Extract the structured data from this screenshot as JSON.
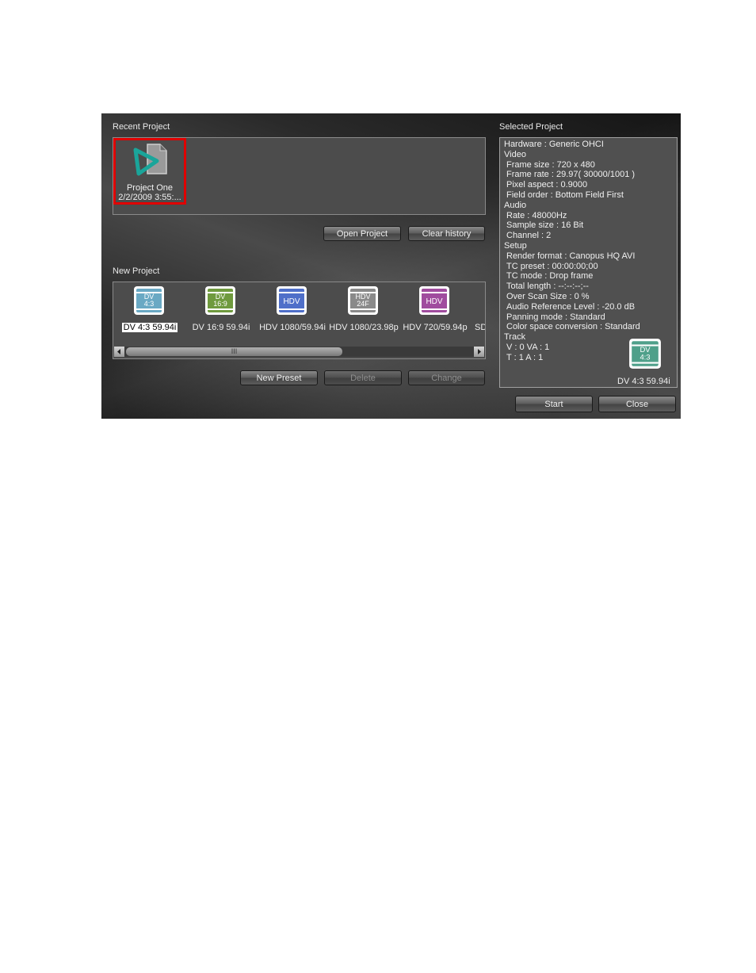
{
  "recent": {
    "title": "Recent Project",
    "items": [
      {
        "name": "Project One",
        "date": "2/2/2009 3:55:..."
      }
    ],
    "open_label": "Open Project",
    "clear_label": "Clear history"
  },
  "new_project": {
    "title": "New Project",
    "presets": [
      {
        "icon_top": "DV",
        "icon_bottom": "4:3",
        "label": "DV 4:3 59.94i",
        "color": "#6aa9c4"
      },
      {
        "icon_top": "DV",
        "icon_bottom": "16:9",
        "label": "DV 16:9 59.94i",
        "color": "#6f9a3e"
      },
      {
        "icon_top": "HDV",
        "icon_bottom": "",
        "label": "HDV 1080/59.94i",
        "color": "#4f6fc9"
      },
      {
        "icon_top": "HDV",
        "icon_bottom": "24F",
        "label": "HDV 1080/23.98p",
        "color": "#8a8a8a"
      },
      {
        "icon_top": "HDV",
        "icon_bottom": "",
        "label": "HDV 720/59.94p",
        "color": "#a04c9e"
      },
      {
        "label": "SD"
      }
    ],
    "scroll_grip": "III",
    "new_preset_label": "New Preset",
    "delete_label": "Delete",
    "change_label": "Change"
  },
  "selected": {
    "title": "Selected Project",
    "lines": [
      "Hardware : Generic OHCI",
      "Video",
      " Frame size : 720 x 480",
      " Frame rate : 29.97( 30000/1001 )",
      " Pixel aspect : 0.9000",
      " Field order : Bottom Field First",
      "Audio",
      " Rate : 48000Hz",
      " Sample size : 16 Bit",
      " Channel : 2",
      "Setup",
      " Render format : Canopus HQ AVI",
      " TC preset : 00:00:00;00",
      " TC mode : Drop frame",
      " Total length : --:--:--;--",
      " Over Scan Size : 0 %",
      " Audio Reference Level : -20.0 dB",
      " Panning mode : Standard",
      " Color space conversion : Standard",
      "Track",
      " V : 0  VA : 1",
      " T : 1  A : 1"
    ],
    "preset_icon_top": "DV",
    "preset_icon_bottom": "4:3",
    "preset_label": "DV 4:3 59.94i",
    "preset_color": "#4fa08a",
    "start_label": "Start",
    "close_label": "Close"
  }
}
